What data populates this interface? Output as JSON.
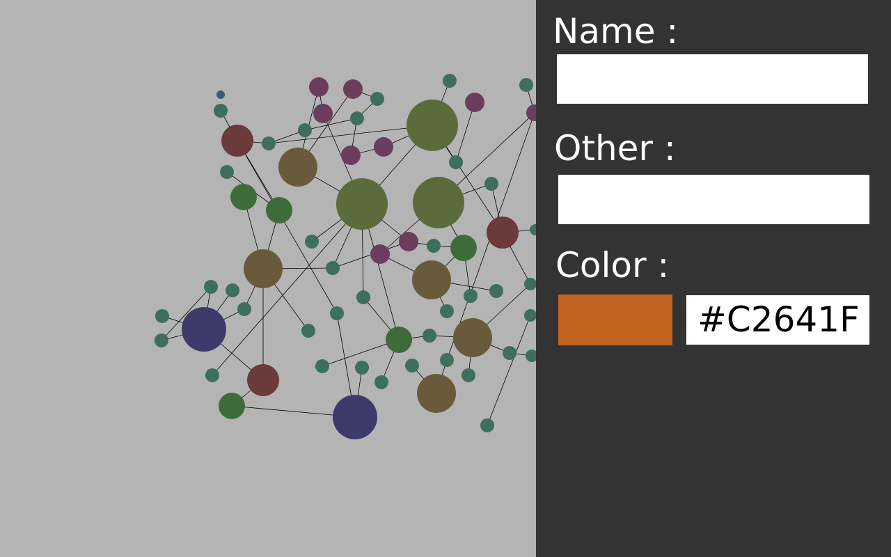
{
  "form": {
    "name_label": "Name :",
    "name_value": "",
    "other_label": "Other :",
    "other_value": "",
    "color_label": "Color :",
    "color_value": "#C2641F"
  },
  "colors": {
    "panel_bg": "#333333",
    "canvas_bg": "#b4b4b4",
    "node_teal": "#3e6f5c",
    "node_purple": "#6b3d5c",
    "node_olive": "#5b6b3c",
    "node_brown": "#6a5a3c",
    "node_red": "#6b3a3a",
    "node_green": "#3e6b3a",
    "node_navy": "#3d3a6b",
    "edge": "#000000"
  }
}
